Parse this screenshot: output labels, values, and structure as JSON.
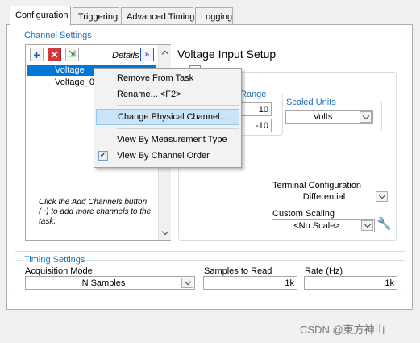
{
  "tabs": [
    "Configuration",
    "Triggering",
    "Advanced Timing",
    "Logging"
  ],
  "channel_settings": {
    "title": "Channel Settings",
    "details_label": "Details",
    "channels": [
      "Voltage",
      "Voltage_0"
    ],
    "hint": "Click the Add Channels button (+) to add more channels to the task."
  },
  "context_menu": {
    "items": [
      "Remove From Task",
      "Rename... <F2>",
      "Change Physical Channel...",
      "View By Measurement Type",
      "View By Channel Order"
    ]
  },
  "voltage_setup": {
    "title": "Voltage Input Setup",
    "range_title": "Range",
    "max_value": "10",
    "min_value": "-10",
    "scaled_units_title": "Scaled Units",
    "scaled_units_value": "Volts",
    "terminal_config_label": "Terminal Configuration",
    "terminal_config_value": "Differential",
    "custom_scaling_label": "Custom Scaling",
    "custom_scaling_value": "<No Scale>"
  },
  "timing_settings": {
    "title": "Timing Settings",
    "acq_mode_label": "Acquisition Mode",
    "acq_mode_value": "N Samples",
    "samples_label": "Samples to Read",
    "samples_value": "1k",
    "rate_label": "Rate (Hz)",
    "rate_value": "1k"
  },
  "watermark": "CSDN @東方神山"
}
